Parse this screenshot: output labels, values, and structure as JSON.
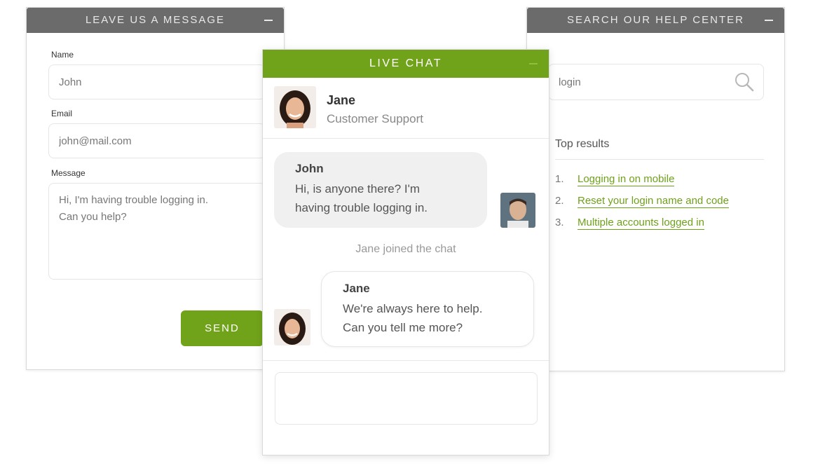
{
  "leave_message": {
    "title": "LEAVE US A MESSAGE",
    "name_label": "Name",
    "name_value": "John",
    "email_label": "Email",
    "email_value": "john@mail.com",
    "message_label": "Message",
    "message_value": "Hi, I'm having trouble logging in.\nCan you help?",
    "send_label": "SEND"
  },
  "live_chat": {
    "title": "LIVE CHAT",
    "agent": {
      "name": "Jane",
      "role": "Customer Support"
    },
    "messages": [
      {
        "sender": "John",
        "text": "Hi, is anyone there? I'm\nhaving trouble logging in."
      },
      {
        "sender": "Jane",
        "text": "We're always here to help.\nCan you tell me more?"
      }
    ],
    "system_message": "Jane joined the chat",
    "input_value": ""
  },
  "help_center": {
    "title": "SEARCH OUR HELP CENTER",
    "search_value": "login",
    "top_results_label": "Top results",
    "results": [
      {
        "num": "1.",
        "label": "Logging in on mobile"
      },
      {
        "num": "2.",
        "label": "Reset your login name and code"
      },
      {
        "num": "3.",
        "label": "Multiple accounts logged in"
      }
    ]
  },
  "colors": {
    "accent_green": "#70a31a",
    "header_gray": "#6b6b6b",
    "link_green": "#6ea11a"
  },
  "icons": {
    "search": "search-icon",
    "minimize": "minimize-icon"
  }
}
